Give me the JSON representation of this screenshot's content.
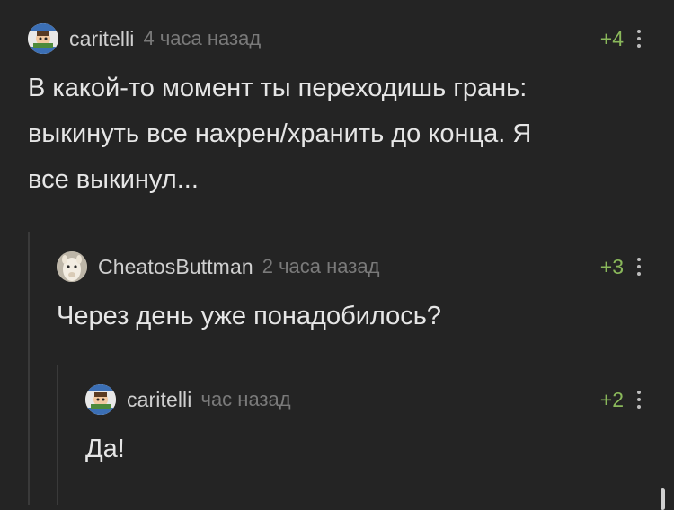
{
  "comments": [
    {
      "username": "caritelli",
      "timestamp": "4 часа назад",
      "rating": "+4",
      "text_lines": [
        "В какой-то момент ты переходишь грань:",
        "выкинуть все нахрен/хранить до конца. Я",
        "все выкинул..."
      ],
      "avatar_icon": "family-guy-meme-avatar"
    },
    {
      "username": "CheatosButtman",
      "timestamp": "2 часа назад",
      "rating": "+3",
      "text_lines": [
        "Через день уже понадобилось?"
      ],
      "avatar_icon": "alpaca-avatar"
    },
    {
      "username": "caritelli",
      "timestamp": "час назад",
      "rating": "+2",
      "text_lines": [
        "Да!"
      ],
      "avatar_icon": "family-guy-meme-avatar"
    }
  ],
  "icons": {
    "more": "vertical-dots-icon"
  },
  "colors": {
    "background": "#242424",
    "rating_positive": "#8ab85b",
    "username": "#cfcfcf",
    "timestamp": "#7a7a7a",
    "text": "#e6e6e6",
    "thread_line": "#3a3a3a"
  }
}
